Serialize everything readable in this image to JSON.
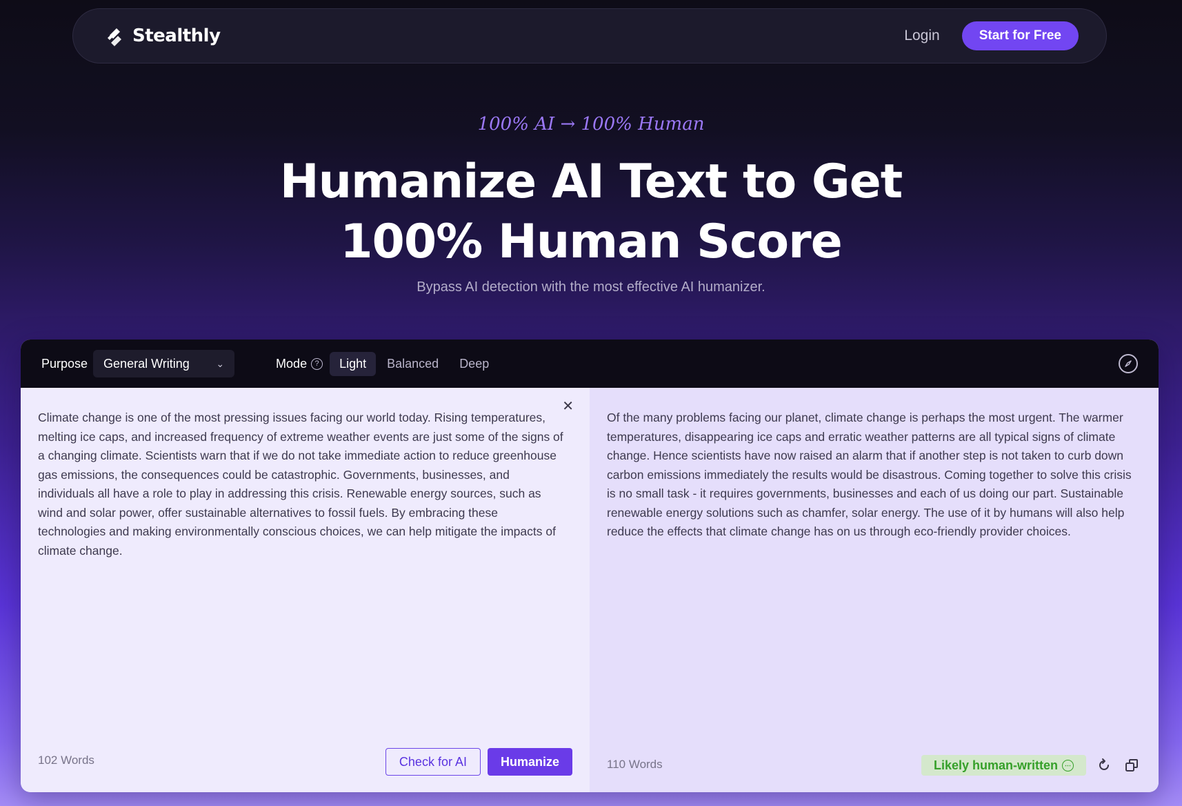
{
  "nav": {
    "brand": "Stealthly",
    "login_label": "Login",
    "cta_label": "Start for Free"
  },
  "hero": {
    "eyebrow": "100% AI → 100% Human",
    "title_line1": "Humanize AI Text to Get",
    "title_line2": "100% Human Score",
    "subtitle": "Bypass AI detection with the most effective AI humanizer."
  },
  "toolbar": {
    "purpose_label": "Purpose",
    "purpose_value": "General Writing",
    "mode_label": "Mode",
    "modes": [
      {
        "label": "Light",
        "active": true
      },
      {
        "label": "Balanced",
        "active": false
      },
      {
        "label": "Deep",
        "active": false
      }
    ]
  },
  "input_pane": {
    "text": "Climate change is one of the most pressing issues facing our world today. Rising temperatures, melting ice caps, and increased frequency of extreme weather events are just some of the signs of a changing climate. Scientists warn that if we do not take immediate action to reduce greenhouse gas emissions, the consequences could be catastrophic. Governments, businesses, and individuals all have a role to play in addressing this crisis. Renewable energy sources, such as wind and solar power, offer sustainable alternatives to fossil fuels. By embracing these technologies and making environmentally conscious choices, we can help mitigate the impacts of climate change.",
    "word_count": "102 Words",
    "check_label": "Check for AI",
    "humanize_label": "Humanize"
  },
  "output_pane": {
    "text": "Of the many problems facing our planet, climate change is perhaps the most urgent. The warmer temperatures, disappearing ice caps and erratic weather patterns are all typical signs of climate change. Hence scientists have now raised an alarm that if another step is not taken to curb down carbon emissions immediately the results would be disastrous. Coming together to solve this crisis is no small task - it requires governments, businesses and each of us doing our part. Sustainable renewable energy solutions such as chamfer, solar energy. The use of it by humans will also help reduce the effects that climate change has on us through eco-friendly provider choices.",
    "word_count": "110 Words",
    "status": "Likely human-written"
  },
  "colors": {
    "accent": "#7246f2",
    "status_green": "#36a02a"
  }
}
